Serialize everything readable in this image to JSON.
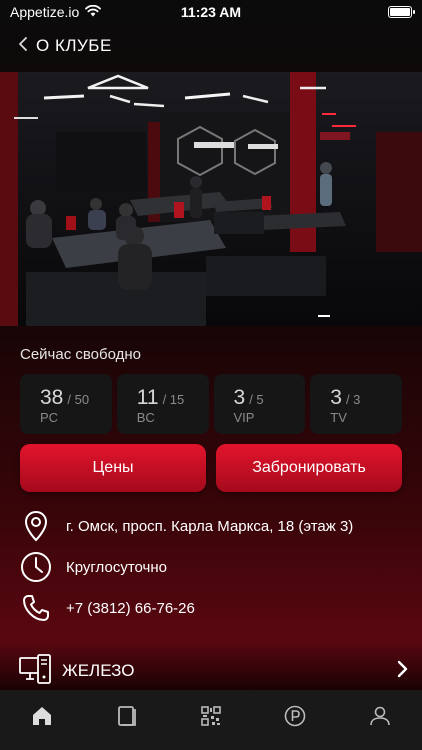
{
  "status_bar": {
    "carrier": "Appetize.io",
    "time": "11:23 AM"
  },
  "nav": {
    "title": "О КЛУБЕ"
  },
  "availability": {
    "label": "Сейчас свободно",
    "stats": [
      {
        "free": "38",
        "total": "/ 50",
        "category": "PC"
      },
      {
        "free": "11",
        "total": "/ 15",
        "category": "BC"
      },
      {
        "free": "3",
        "total": "/ 5",
        "category": "VIP"
      },
      {
        "free": "3",
        "total": "/ 3",
        "category": "TV"
      }
    ]
  },
  "actions": {
    "prices_label": "Цены",
    "book_label": "Забронировать"
  },
  "info": {
    "address": "г. Омск, просп. Карла Маркса, 18 (этаж 3)",
    "hours": "Круглосуточно",
    "phone": "+7 (3812) 66-76-26"
  },
  "hardware": {
    "label": "ЖЕЛЕЗО"
  },
  "tab_bar": {
    "tabs": [
      "home-icon",
      "bookings-icon",
      "qr-code-icon",
      "parking-icon",
      "profile-icon"
    ]
  },
  "colors": {
    "accent": "#d0102a",
    "card": "#161616",
    "tab_bar": "#191919"
  }
}
